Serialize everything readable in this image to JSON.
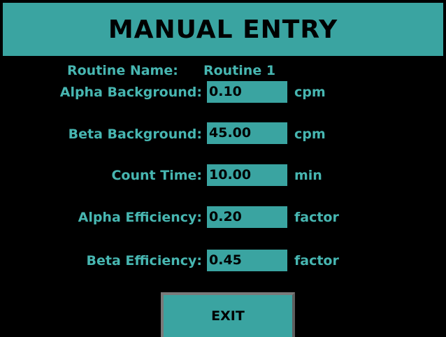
{
  "title": "MANUAL ENTRY",
  "routine": {
    "label": "Routine Name:",
    "value": "Routine 1"
  },
  "fields": [
    {
      "label": "Alpha Background:",
      "value": "0.10",
      "unit": "cpm"
    },
    {
      "label": "Beta Background:",
      "value": "45.00",
      "unit": "cpm"
    },
    {
      "label": "Count Time:",
      "value": "10.00",
      "unit": "min"
    },
    {
      "label": "Alpha Efficiency:",
      "value": "0.20",
      "unit": "factor"
    },
    {
      "label": "Beta Efficiency:",
      "value": "0.45",
      "unit": "factor"
    }
  ],
  "exit_label": "EXIT",
  "colors": {
    "background": "#000000",
    "accent": "#3aa4a1",
    "label_text": "#47b6b1"
  }
}
